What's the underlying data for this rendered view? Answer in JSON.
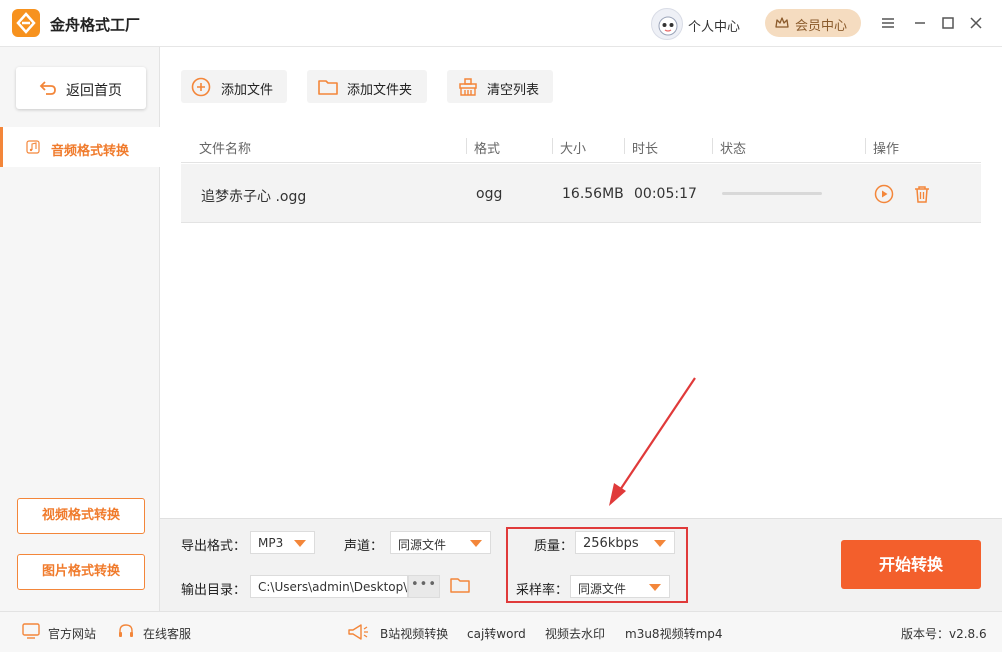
{
  "app": {
    "title": "金舟格式工厂",
    "user_center": "个人中心",
    "vip": "会员中心"
  },
  "sidebar": {
    "back": "返回首页",
    "active": "音频格式转换",
    "video": "视频格式转换",
    "image": "图片格式转换"
  },
  "toolbar": {
    "add_file": "添加文件",
    "add_folder": "添加文件夹",
    "clear": "清空列表"
  },
  "table": {
    "headers": [
      "文件名称",
      "格式",
      "大小",
      "时长",
      "状态",
      "操作"
    ],
    "rows": [
      {
        "name": "追梦赤子心 .ogg",
        "format": "ogg",
        "size": "16.56MB",
        "duration": "00:05:17",
        "progress": 0
      }
    ]
  },
  "settings": {
    "output_format_label": "导出格式：",
    "output_format": "MP3",
    "channel_label": "声道：",
    "channel": "同源文件",
    "quality_label": "质量：",
    "quality": "256kbps",
    "sample_rate_label": "采样率：",
    "sample_rate": "同源文件",
    "output_dir_label": "输出目录：",
    "output_dir": "C:\\Users\\admin\\Desktop\\",
    "dots": "•••",
    "start": "开始转换"
  },
  "statusbar": {
    "website": "官方网站",
    "service": "在线客服",
    "links": [
      "B站视频转换",
      "caj转word",
      "视频去水印",
      "m3u8视频转mp4"
    ],
    "version": "版本号：v2.8.6"
  },
  "colors": {
    "accent": "#f3863a",
    "start": "#f35f2c",
    "highlight": "#e03a3a"
  }
}
